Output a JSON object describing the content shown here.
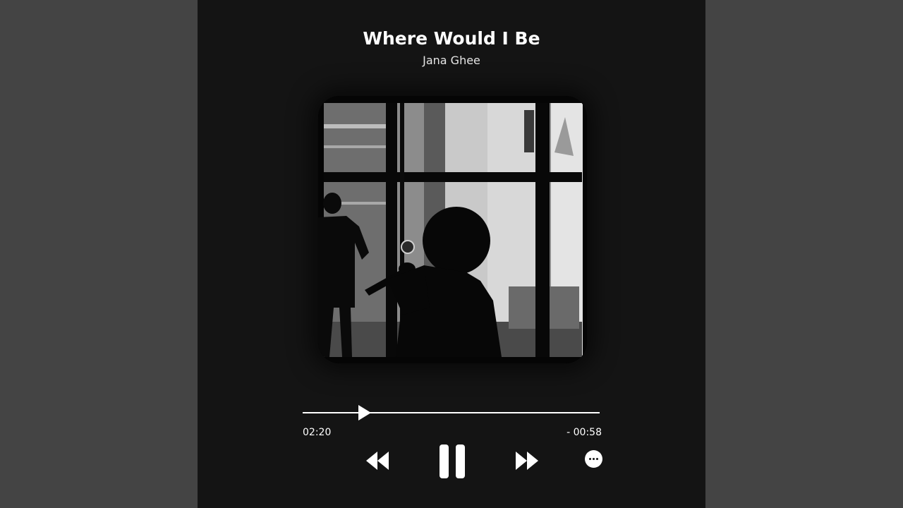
{
  "track": {
    "title": "Where Would I Be",
    "artist": "Jana Ghee"
  },
  "artwork": {
    "description_icon": "album-cover-image"
  },
  "playback": {
    "elapsed": "02:20",
    "remaining": "- 00:58",
    "progress": 0.21,
    "state": "playing"
  },
  "controls": {
    "rewind_icon": "rewind-icon",
    "pause_icon": "pause-icon",
    "fast_forward_icon": "fast-forward-icon",
    "more_icon": "more-options-icon"
  },
  "colors": {
    "background": "#444444",
    "card": "#141414",
    "foreground": "#ffffff"
  }
}
